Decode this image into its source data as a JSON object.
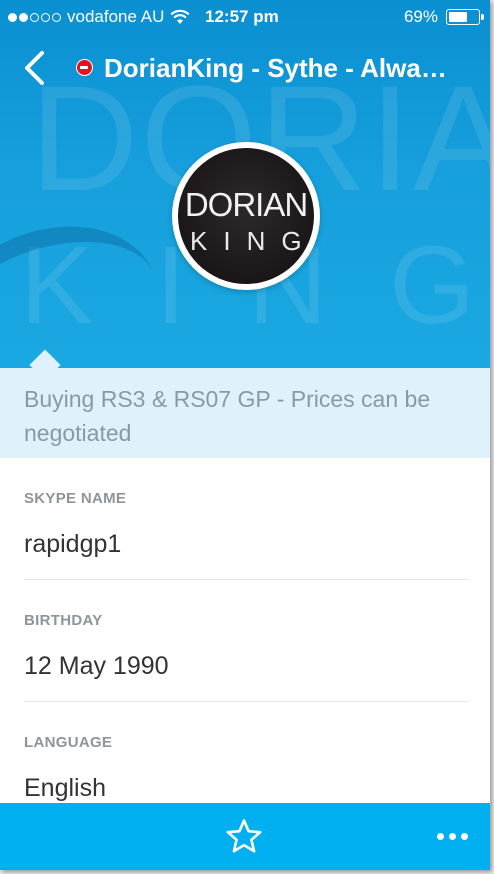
{
  "status_bar": {
    "carrier": "vodafone AU",
    "signal_bars_filled": 2,
    "signal_bars_total": 5,
    "time": "12:57 pm",
    "battery_percent": "69%",
    "battery_level": 0.69
  },
  "nav": {
    "title": "DorianKing - Sythe - Alwa…",
    "presence_status": "do-not-disturb",
    "back_icon": "chevron-left-icon"
  },
  "avatar": {
    "line1": "DORIAN",
    "line2": "KING"
  },
  "mood_message": "Buying RS3 & RS07 GP - Prices can be negotiated",
  "fields": [
    {
      "label": "SKYPE NAME",
      "value": "rapidgp1"
    },
    {
      "label": "BIRTHDAY",
      "value": "12 May 1990"
    },
    {
      "label": "LANGUAGE",
      "value": "English"
    }
  ],
  "bottom_bar": {
    "favorite_icon": "star-icon",
    "more_icon": "more-horizontal-icon"
  },
  "colors": {
    "header_blue": "#169fdc",
    "mood_background": "#dff1fa",
    "tab_bar": "#00aff0",
    "presence_red": "#e81123",
    "label_gray": "#8e9498"
  }
}
